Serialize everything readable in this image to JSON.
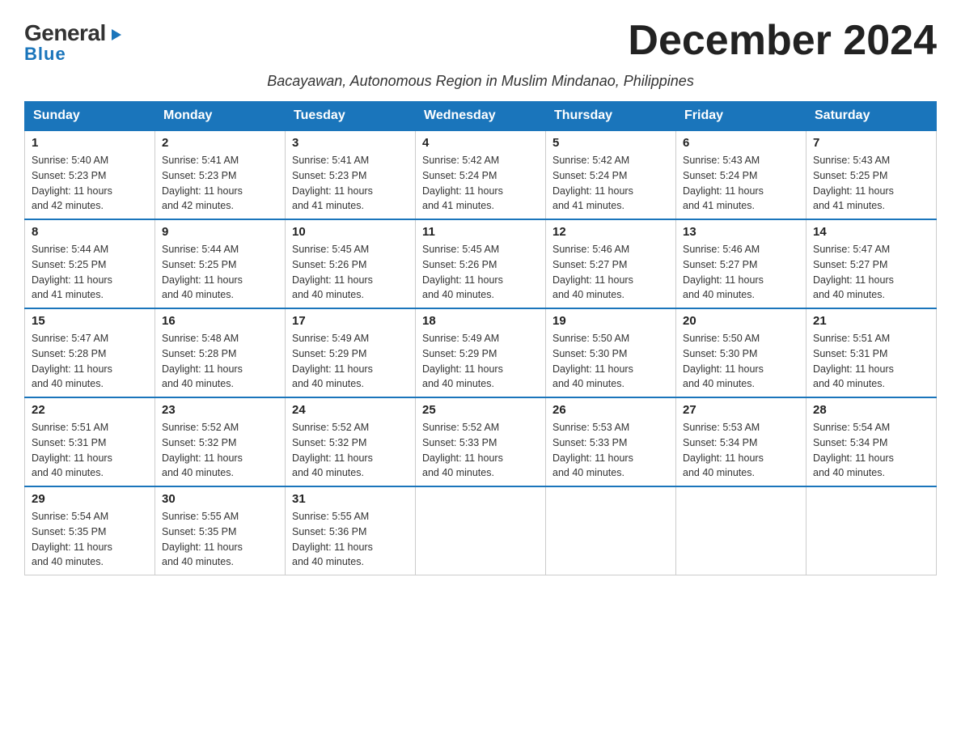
{
  "logo": {
    "general": "General",
    "blue": "Blue",
    "triangle_char": "▶"
  },
  "header": {
    "month_title": "December 2024",
    "subtitle": "Bacayawan, Autonomous Region in Muslim Mindanao, Philippines"
  },
  "days_of_week": [
    "Sunday",
    "Monday",
    "Tuesday",
    "Wednesday",
    "Thursday",
    "Friday",
    "Saturday"
  ],
  "weeks": [
    [
      {
        "day": "1",
        "sunrise": "5:40 AM",
        "sunset": "5:23 PM",
        "daylight": "11 hours and 42 minutes."
      },
      {
        "day": "2",
        "sunrise": "5:41 AM",
        "sunset": "5:23 PM",
        "daylight": "11 hours and 42 minutes."
      },
      {
        "day": "3",
        "sunrise": "5:41 AM",
        "sunset": "5:23 PM",
        "daylight": "11 hours and 41 minutes."
      },
      {
        "day": "4",
        "sunrise": "5:42 AM",
        "sunset": "5:24 PM",
        "daylight": "11 hours and 41 minutes."
      },
      {
        "day": "5",
        "sunrise": "5:42 AM",
        "sunset": "5:24 PM",
        "daylight": "11 hours and 41 minutes."
      },
      {
        "day": "6",
        "sunrise": "5:43 AM",
        "sunset": "5:24 PM",
        "daylight": "11 hours and 41 minutes."
      },
      {
        "day": "7",
        "sunrise": "5:43 AM",
        "sunset": "5:25 PM",
        "daylight": "11 hours and 41 minutes."
      }
    ],
    [
      {
        "day": "8",
        "sunrise": "5:44 AM",
        "sunset": "5:25 PM",
        "daylight": "11 hours and 41 minutes."
      },
      {
        "day": "9",
        "sunrise": "5:44 AM",
        "sunset": "5:25 PM",
        "daylight": "11 hours and 40 minutes."
      },
      {
        "day": "10",
        "sunrise": "5:45 AM",
        "sunset": "5:26 PM",
        "daylight": "11 hours and 40 minutes."
      },
      {
        "day": "11",
        "sunrise": "5:45 AM",
        "sunset": "5:26 PM",
        "daylight": "11 hours and 40 minutes."
      },
      {
        "day": "12",
        "sunrise": "5:46 AM",
        "sunset": "5:27 PM",
        "daylight": "11 hours and 40 minutes."
      },
      {
        "day": "13",
        "sunrise": "5:46 AM",
        "sunset": "5:27 PM",
        "daylight": "11 hours and 40 minutes."
      },
      {
        "day": "14",
        "sunrise": "5:47 AM",
        "sunset": "5:27 PM",
        "daylight": "11 hours and 40 minutes."
      }
    ],
    [
      {
        "day": "15",
        "sunrise": "5:47 AM",
        "sunset": "5:28 PM",
        "daylight": "11 hours and 40 minutes."
      },
      {
        "day": "16",
        "sunrise": "5:48 AM",
        "sunset": "5:28 PM",
        "daylight": "11 hours and 40 minutes."
      },
      {
        "day": "17",
        "sunrise": "5:49 AM",
        "sunset": "5:29 PM",
        "daylight": "11 hours and 40 minutes."
      },
      {
        "day": "18",
        "sunrise": "5:49 AM",
        "sunset": "5:29 PM",
        "daylight": "11 hours and 40 minutes."
      },
      {
        "day": "19",
        "sunrise": "5:50 AM",
        "sunset": "5:30 PM",
        "daylight": "11 hours and 40 minutes."
      },
      {
        "day": "20",
        "sunrise": "5:50 AM",
        "sunset": "5:30 PM",
        "daylight": "11 hours and 40 minutes."
      },
      {
        "day": "21",
        "sunrise": "5:51 AM",
        "sunset": "5:31 PM",
        "daylight": "11 hours and 40 minutes."
      }
    ],
    [
      {
        "day": "22",
        "sunrise": "5:51 AM",
        "sunset": "5:31 PM",
        "daylight": "11 hours and 40 minutes."
      },
      {
        "day": "23",
        "sunrise": "5:52 AM",
        "sunset": "5:32 PM",
        "daylight": "11 hours and 40 minutes."
      },
      {
        "day": "24",
        "sunrise": "5:52 AM",
        "sunset": "5:32 PM",
        "daylight": "11 hours and 40 minutes."
      },
      {
        "day": "25",
        "sunrise": "5:52 AM",
        "sunset": "5:33 PM",
        "daylight": "11 hours and 40 minutes."
      },
      {
        "day": "26",
        "sunrise": "5:53 AM",
        "sunset": "5:33 PM",
        "daylight": "11 hours and 40 minutes."
      },
      {
        "day": "27",
        "sunrise": "5:53 AM",
        "sunset": "5:34 PM",
        "daylight": "11 hours and 40 minutes."
      },
      {
        "day": "28",
        "sunrise": "5:54 AM",
        "sunset": "5:34 PM",
        "daylight": "11 hours and 40 minutes."
      }
    ],
    [
      {
        "day": "29",
        "sunrise": "5:54 AM",
        "sunset": "5:35 PM",
        "daylight": "11 hours and 40 minutes."
      },
      {
        "day": "30",
        "sunrise": "5:55 AM",
        "sunset": "5:35 PM",
        "daylight": "11 hours and 40 minutes."
      },
      {
        "day": "31",
        "sunrise": "5:55 AM",
        "sunset": "5:36 PM",
        "daylight": "11 hours and 40 minutes."
      },
      null,
      null,
      null,
      null
    ]
  ],
  "labels": {
    "sunrise": "Sunrise:",
    "sunset": "Sunset:",
    "daylight": "Daylight:"
  }
}
